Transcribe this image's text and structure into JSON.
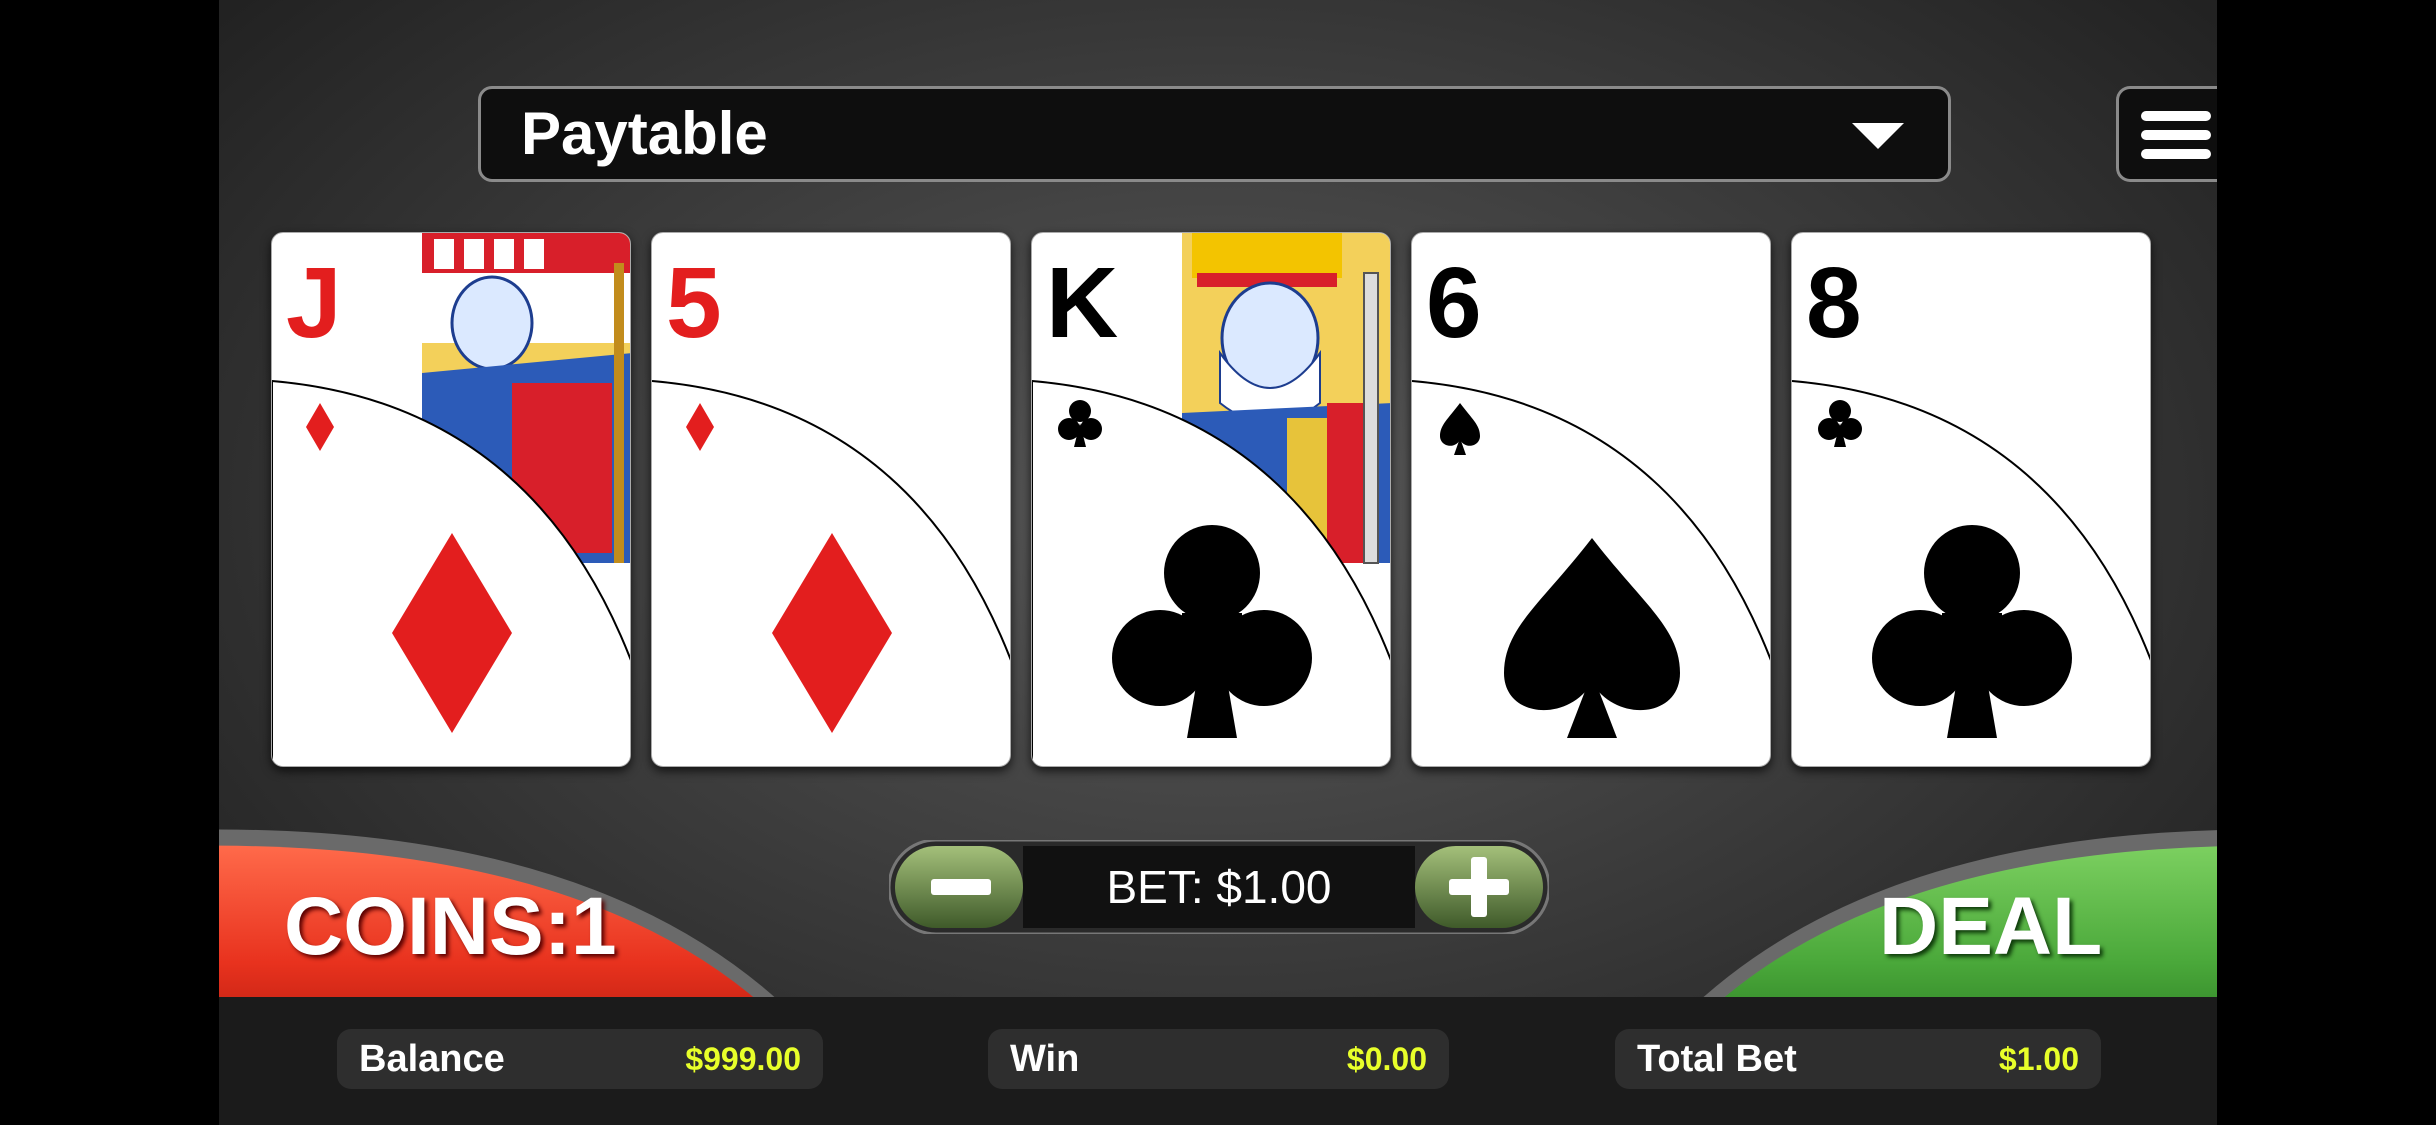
{
  "header": {
    "paytable_label": "Paytable"
  },
  "cards": [
    {
      "rank": "J",
      "suit": "diamonds",
      "color": "#e31e1e",
      "face": "jack"
    },
    {
      "rank": "5",
      "suit": "diamonds",
      "color": "#e31e1e",
      "face": null
    },
    {
      "rank": "K",
      "suit": "clubs",
      "color": "#000000",
      "face": "king"
    },
    {
      "rank": "6",
      "suit": "spades",
      "color": "#000000",
      "face": null
    },
    {
      "rank": "8",
      "suit": "clubs",
      "color": "#000000",
      "face": null
    }
  ],
  "controls": {
    "coins_label": "COINS:1",
    "bet_label": "BET: $1.00",
    "minus_icon": "minus-icon",
    "plus_icon": "plus-icon",
    "deal_label": "DEAL"
  },
  "stats": {
    "balance_label": "Balance",
    "balance_value": "$999.00",
    "win_label": "Win",
    "win_value": "$0.00",
    "total_bet_label": "Total Bet",
    "total_bet_value": "$1.00"
  },
  "colors": {
    "coins_red": "#e8321e",
    "deal_green": "#4aa83a",
    "stat_value": "#e8ff2a"
  }
}
